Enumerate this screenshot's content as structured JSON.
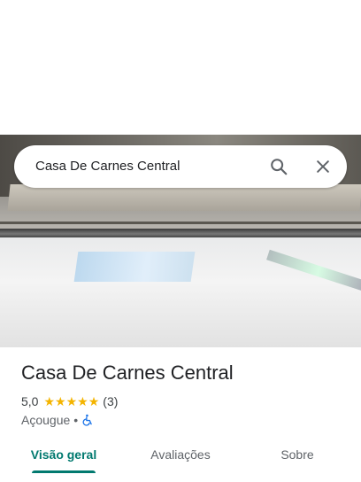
{
  "search": {
    "query": "Casa De Carnes Central"
  },
  "place": {
    "title": "Casa De Carnes Central",
    "rating": "5,0",
    "stars": 5,
    "review_count": "(3)",
    "category": "Açougue",
    "separator": "•"
  },
  "tabs": [
    {
      "label": "Visão geral",
      "active": true
    },
    {
      "label": "Avaliações",
      "active": false
    },
    {
      "label": "Sobre",
      "active": false
    }
  ],
  "colors": {
    "accent": "#01796f",
    "star": "#f4b400",
    "accessibility": "#1a73e8"
  },
  "icons": [
    "search-icon",
    "close-icon",
    "star-icon",
    "wheelchair-accessible-icon"
  ]
}
